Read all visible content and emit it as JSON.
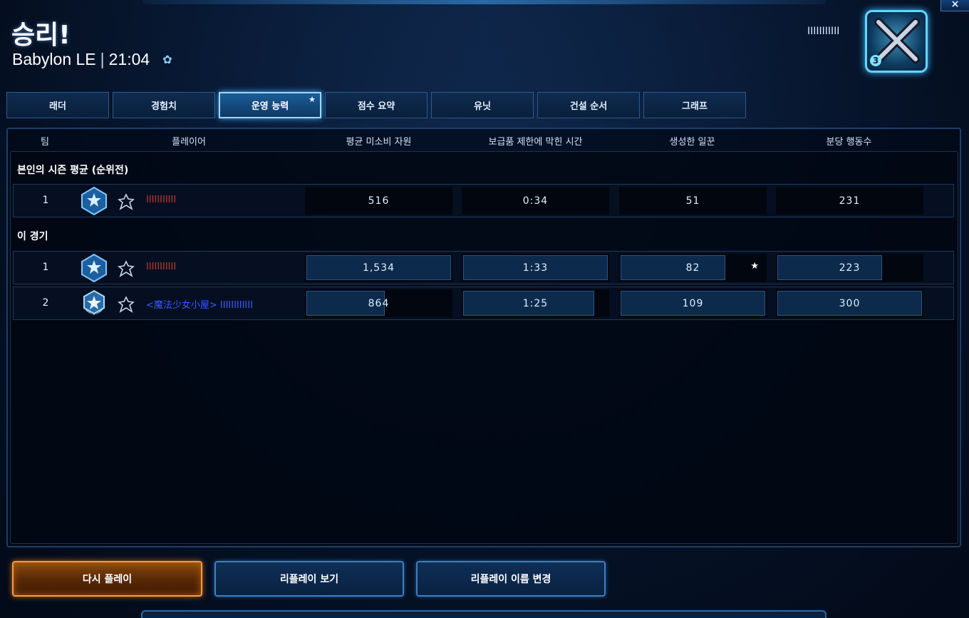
{
  "header": {
    "title": "승리!",
    "map_name": "Babylon LE",
    "separator": "|",
    "duration": "21:04",
    "player_name": "IIIIIIIIIII",
    "rank_level": "3"
  },
  "window": {
    "close_label": "×"
  },
  "tabs": [
    {
      "label": "래더",
      "active": false
    },
    {
      "label": "경험치",
      "active": false
    },
    {
      "label": "운영 능력",
      "active": true,
      "star": "★"
    },
    {
      "label": "점수 요약",
      "active": false
    },
    {
      "label": "유닛",
      "active": false
    },
    {
      "label": "건설 순서",
      "active": false
    },
    {
      "label": "그래프",
      "active": false
    }
  ],
  "columns": {
    "team": "팀",
    "player": "플레이어",
    "unspent": "평균 미소비 자원",
    "supply_blocked": "보급품 제한에 막힌 시간",
    "workers": "생성한 일꾼",
    "apm": "분당 행동수"
  },
  "season_section": {
    "title": "본인의 시즌 평균 (순위전)",
    "rows": [
      {
        "team": "1",
        "player": "IIIIIIIIIII",
        "player_color": "#c0392b",
        "unspent": "516",
        "supply_blocked": "0:34",
        "workers": "51",
        "apm": "231"
      }
    ]
  },
  "game_section": {
    "title": "이 경기",
    "rows": [
      {
        "team": "1",
        "player": "IIIIIIIIIII",
        "player_color": "#c0392b",
        "unspent": "1,534",
        "supply_blocked": "1:33",
        "workers": "82",
        "workers_star": "★",
        "apm": "223",
        "fills": {
          "unspent": 1.0,
          "supply_blocked": 1.0,
          "workers": 0.73,
          "apm": 0.73
        }
      },
      {
        "team": "2",
        "player": "<魔法少女小屋> IIIIIIIIIIII",
        "player_color": "#3a5dff",
        "unspent": "864",
        "supply_blocked": "1:25",
        "workers": "109",
        "apm": "300",
        "fills": {
          "unspent": 0.55,
          "supply_blocked": 0.91,
          "workers": 1.0,
          "apm": 1.0
        }
      }
    ]
  },
  "buttons": {
    "play_again": "다시 플레이",
    "watch_replay": "리플레이 보기",
    "rename_replay": "리플레이 이름 변경"
  },
  "icons": {
    "settings": "gear-icon",
    "race": "terran-icon",
    "league": "diamond-league-icon"
  },
  "colors": {
    "accent": "#3fa8ff",
    "primary_button": "#f0a040",
    "player1": "#c0392b",
    "player2": "#3a5dff"
  }
}
